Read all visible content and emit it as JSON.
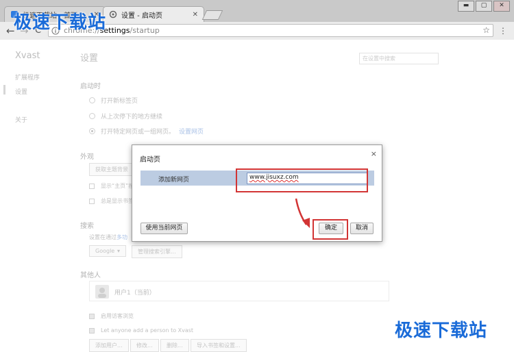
{
  "watermark": {
    "text": "极速下载站"
  },
  "window": {
    "tabs": [
      {
        "title": "极速下载站 - 首页"
      },
      {
        "title": "设置 - 启动页"
      }
    ],
    "controls": {
      "minimize": "▬",
      "restore": "▢",
      "close": "✕"
    }
  },
  "toolbar": {
    "back": "←",
    "forward": "→",
    "reload": "C",
    "url_scheme": "chrome://",
    "url_host": "settings",
    "url_path": "/startup",
    "star": "☆",
    "menu": "⋮"
  },
  "sidebar": {
    "title": "Xvast",
    "items": [
      {
        "label": "扩展程序"
      },
      {
        "label": "设置"
      },
      {
        "label": "关于"
      }
    ]
  },
  "settings": {
    "title": "设置",
    "search_placeholder": "在设置中搜索",
    "startup": {
      "heading": "启动时",
      "options": [
        {
          "label": "打开新标签页",
          "selected": false
        },
        {
          "label": "从上次停下的地方继续",
          "selected": false
        },
        {
          "label": "打开特定网页或一组网页。",
          "selected": true,
          "link": "设置网页"
        }
      ]
    },
    "appearance": {
      "heading": "外观",
      "theme_button": "获取主题背景",
      "show_home": "显示“主页”按",
      "show_bookmarks": "总是显示书签"
    },
    "search": {
      "heading": "搜索",
      "desc": "设置在通过",
      "desc_link": "多功",
      "engine": "Google",
      "manage": "管理搜索引擎..."
    },
    "others": {
      "heading": "其他人",
      "user": "用户1（当前）",
      "guest": "启用访客浏览",
      "anyone": "Let anyone add a person to Xvast",
      "buttons": [
        "添加用户...",
        "修改...",
        "删除...",
        "导入书签和设置..."
      ]
    }
  },
  "dialog": {
    "title": "启动页",
    "close": "×",
    "add_label": "添加新网页",
    "url_value": "www.jisuxz.com",
    "use_current": "使用当前网页",
    "ok": "确定",
    "cancel": "取消"
  }
}
